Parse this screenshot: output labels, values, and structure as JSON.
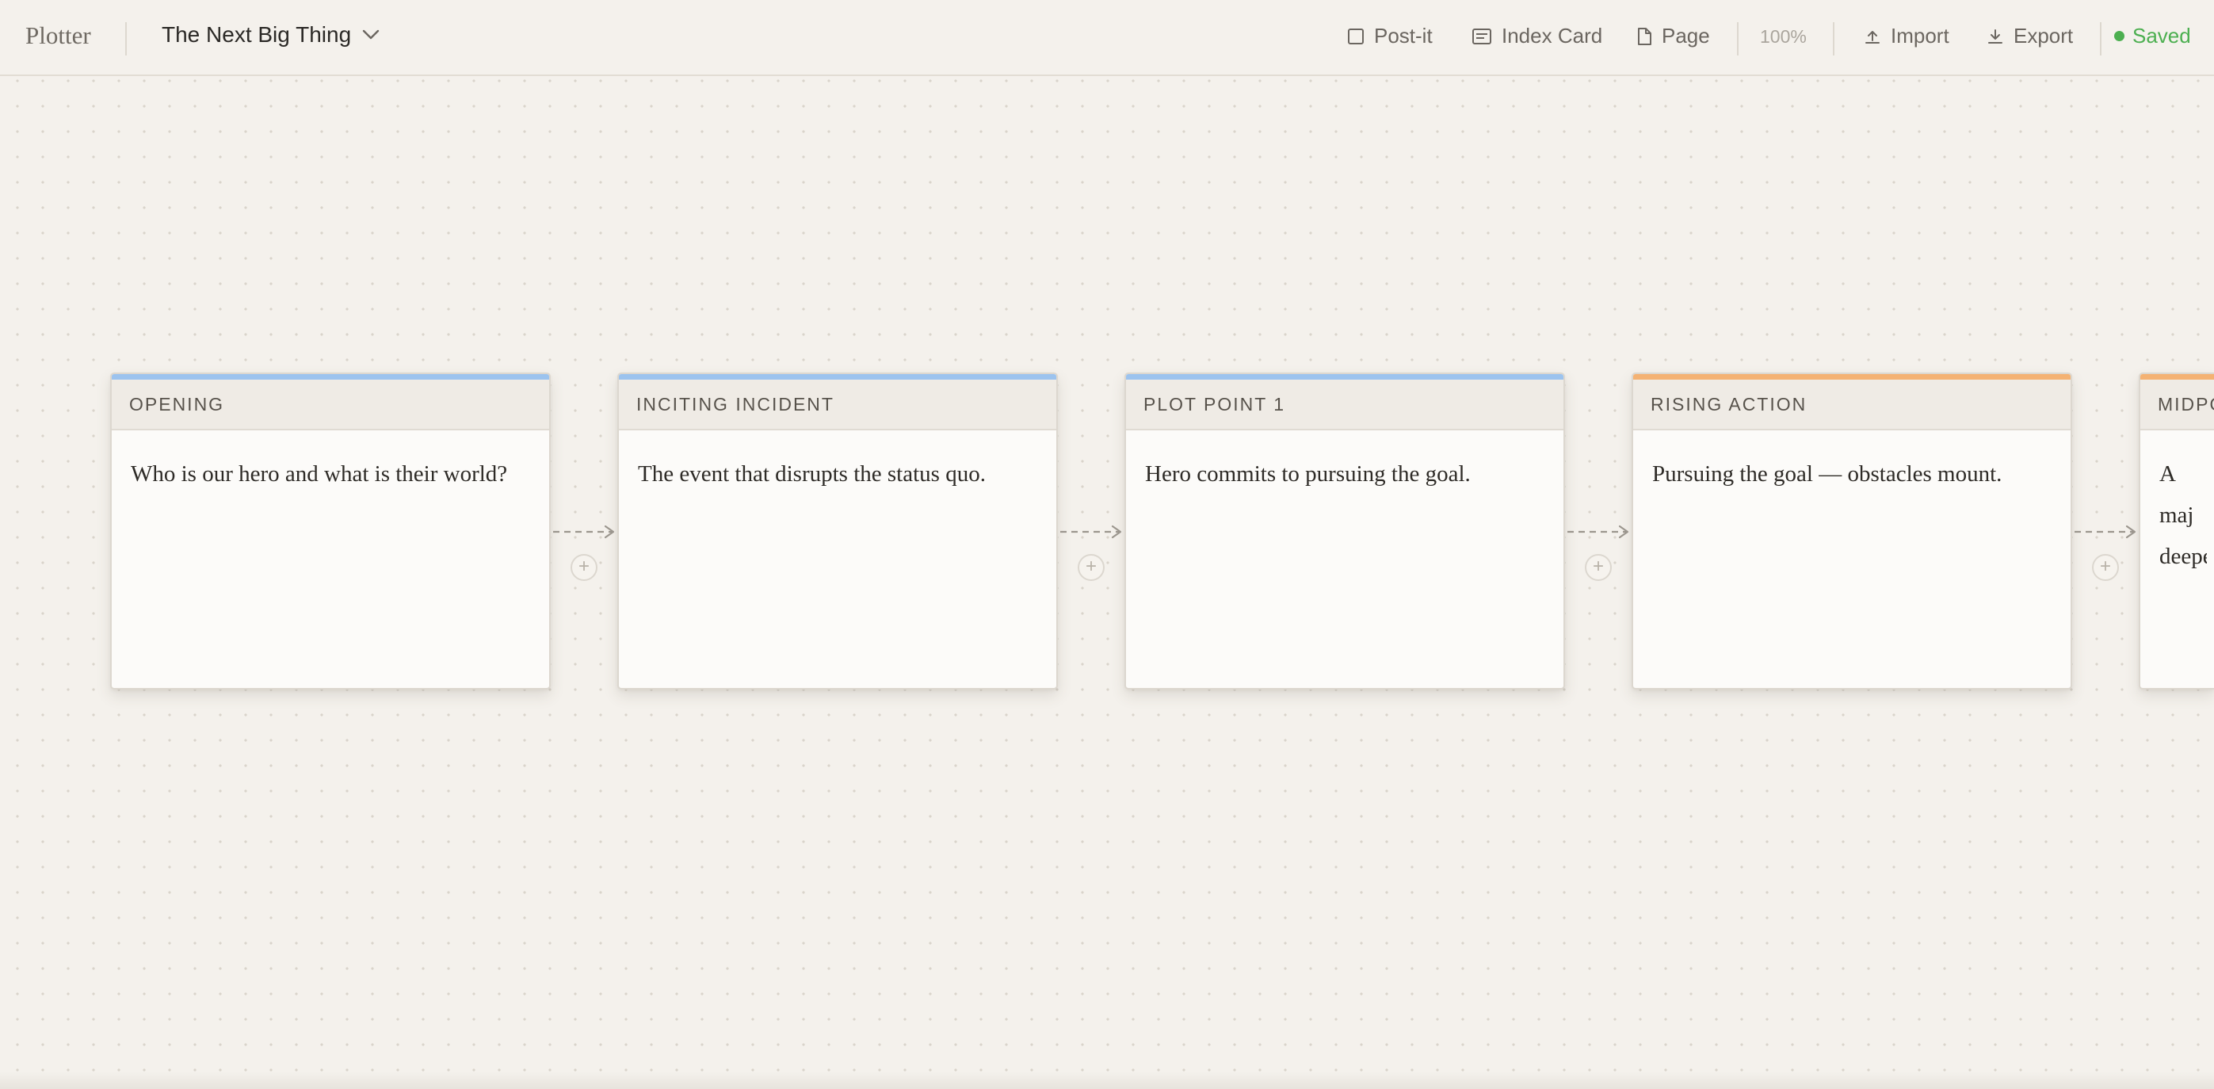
{
  "app": {
    "name": "Plotter"
  },
  "document": {
    "title": "The Next Big Thing"
  },
  "toolbar": {
    "postit_label": "Post-it",
    "indexcard_label": "Index Card",
    "page_label": "Page",
    "zoom": "100%",
    "import_label": "Import",
    "export_label": "Export",
    "status": "Saved"
  },
  "colors": {
    "blue_band": "#9cc3ee",
    "orange_band": "#f4b273",
    "saved_green": "#4caf50"
  },
  "cards": [
    {
      "title": "OPENING",
      "text": "Who is our hero and what is their world?",
      "band": "blue"
    },
    {
      "title": "INCITING INCIDENT",
      "text": "The event that disrupts the status quo.",
      "band": "blue"
    },
    {
      "title": "PLOT POINT 1",
      "text": "Hero commits to pursuing the goal.",
      "band": "blue"
    },
    {
      "title": "RISING ACTION",
      "text": "Pursuing the goal — obstacles mount.",
      "band": "orange"
    },
    {
      "title": "MIDPO",
      "text": "A maj deeper",
      "band": "orange"
    }
  ],
  "connector": {
    "add_symbol": "+"
  }
}
